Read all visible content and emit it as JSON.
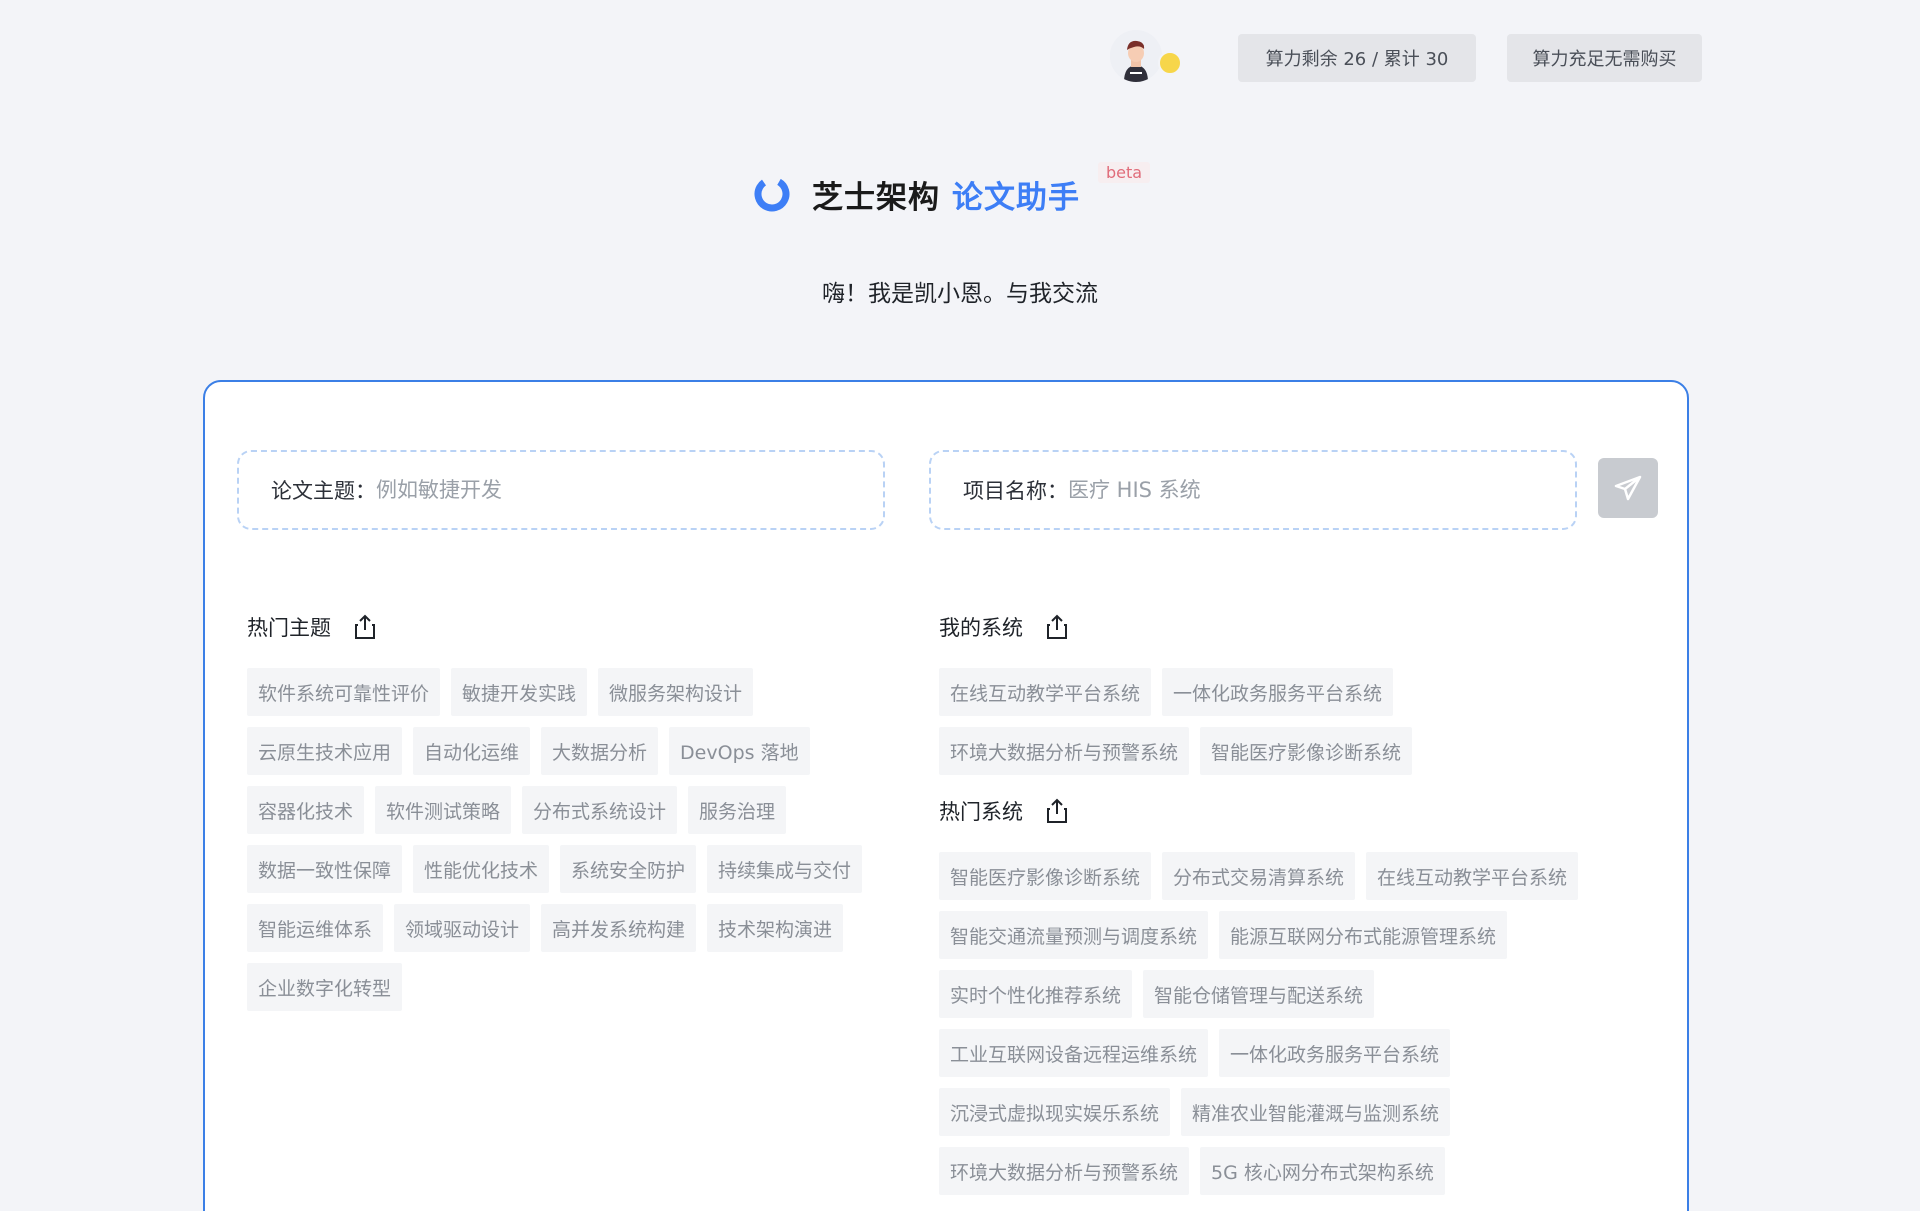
{
  "header": {
    "power_label": "算力剩余 26 / 累计 30",
    "buy_label": "算力充足无需购买"
  },
  "brand": {
    "name": "芝士架构",
    "product": "论文助手",
    "badge": "beta",
    "greeting": "嗨！我是凯小恩。与我交流"
  },
  "form": {
    "topic_label": "论文主题：",
    "topic_placeholder": "例如敏捷开发",
    "project_label": "项目名称：",
    "project_placeholder": "医疗 HIS 系统"
  },
  "hot_topics": {
    "title": "热门主题",
    "items": [
      "软件系统可靠性评价",
      "敏捷开发实践",
      "微服务架构设计",
      "云原生技术应用",
      "自动化运维",
      "大数据分析",
      "DevOps 落地",
      "容器化技术",
      "软件测试策略",
      "分布式系统设计",
      "服务治理",
      "数据一致性保障",
      "性能优化技术",
      "系统安全防护",
      "持续集成与交付",
      "智能运维体系",
      "领域驱动设计",
      "高并发系统构建",
      "技术架构演进",
      "企业数字化转型"
    ]
  },
  "my_systems": {
    "title": "我的系统",
    "items": [
      "在线互动教学平台系统",
      "一体化政务服务平台系统",
      "环境大数据分析与预警系统",
      "智能医疗影像诊断系统"
    ]
  },
  "hot_systems": {
    "title": "热门系统",
    "items": [
      "智能医疗影像诊断系统",
      "分布式交易清算系统",
      "在线互动教学平台系统",
      "智能交通流量预测与调度系统",
      "能源互联网分布式能源管理系统",
      "实时个性化推荐系统",
      "智能仓储管理与配送系统",
      "工业互联网设备远程运维系统",
      "一体化政务服务平台系统",
      "沉浸式虚拟现实娱乐系统",
      "精准农业智能灌溉与监测系统",
      "环境大数据分析与预警系统",
      "5G 核心网分布式架构系统"
    ]
  },
  "colors": {
    "accent": "#3d7ef6",
    "card_border": "#3b7fe6",
    "tag_bg": "#f4f5f7",
    "tag_text": "#8a8f97",
    "beta": "#e06c7a"
  }
}
